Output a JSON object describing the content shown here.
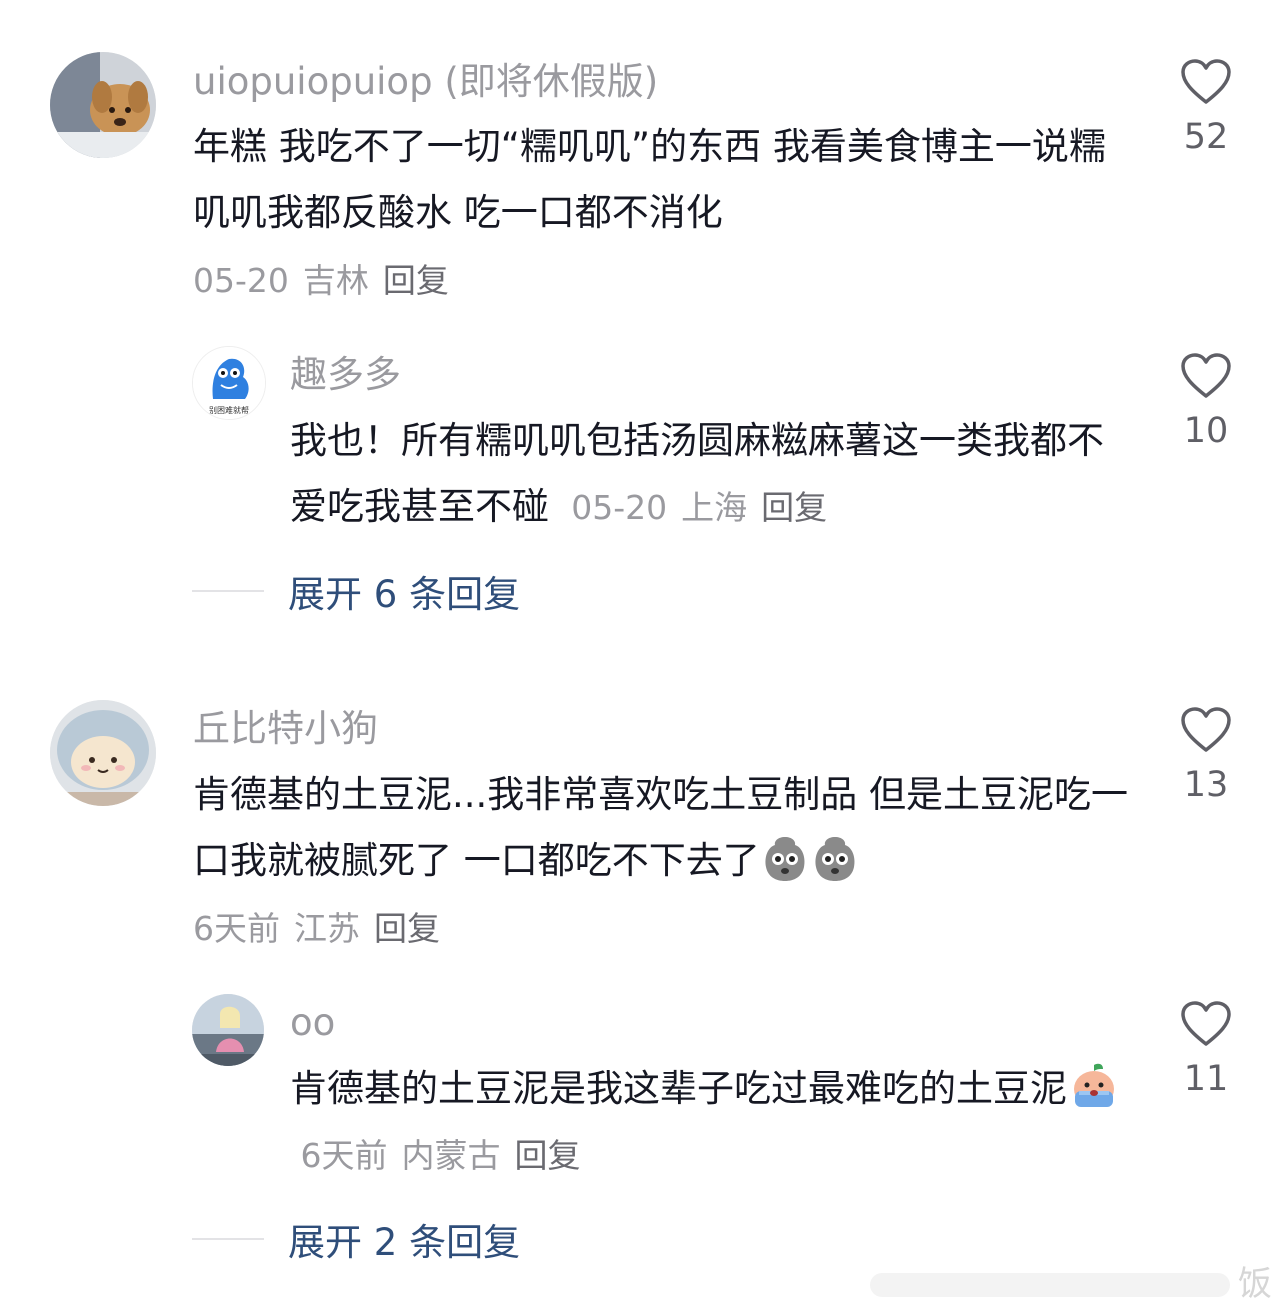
{
  "comments": [
    {
      "username": "uiopuiopuiop (即将休假版)",
      "text": "年糕 我吃不了一切“糯叽叽”的东西 我看美食博主一说糯叽叽我都反酸水 吃一口都不消化",
      "date": "05-20",
      "location": "吉林",
      "reply_label": "回复",
      "likes": "52",
      "avatar": "dog-avatar"
    },
    {
      "username": "趣多多",
      "text": "我也！所有糯叽叽包括汤圆麻糍麻薯这一类我都不爱吃我甚至不碰",
      "date": "05-20",
      "location": "上海",
      "reply_label": "回复",
      "likes": "10",
      "avatar": "blue-mascot-avatar",
      "avatar_text": "别困难就帮"
    },
    {
      "username": "丘比特小狗",
      "text": "肯德基的土豆泥...我非常喜欢吃土豆制品 但是土豆泥吃一口我就被腻死了 一口都吃不下去了",
      "date": "6天前",
      "location": "江苏",
      "reply_label": "回复",
      "likes": "13",
      "avatar": "plush-avatar",
      "emojis": [
        "potato-emoji",
        "potato-emoji"
      ]
    },
    {
      "username": "oo",
      "text_part1": "肯德基的土豆泥是我这辈子吃过最难吃的土豆",
      "text_part2": "泥",
      "date": "6天前",
      "location": "内蒙古",
      "reply_label": "回复",
      "likes": "11",
      "avatar": "girl-avatar",
      "emojis": [
        "crying-peach-emoji"
      ]
    }
  ],
  "expand_replies": [
    "展开 6 条回复",
    "展开 2 条回复"
  ],
  "watermark": "饭",
  "colors": {
    "username": "#9a9a9f",
    "content": "#161823",
    "expand": "#2f4e7a",
    "like_outline": "#5f5f66"
  }
}
